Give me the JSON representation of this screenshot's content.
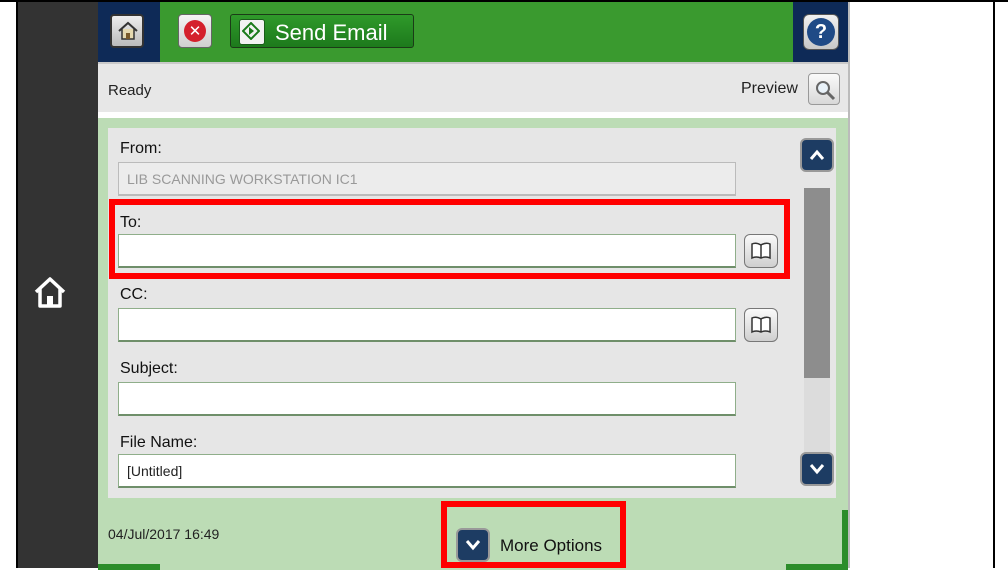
{
  "header": {
    "title": "Send Email",
    "home_icon": "home-icon",
    "cancel_icon": "cancel-icon",
    "help_icon": "help-icon"
  },
  "status": {
    "text": "Ready",
    "preview_label": "Preview"
  },
  "form": {
    "from": {
      "label": "From:",
      "value": "LIB SCANNING WORKSTATION IC1"
    },
    "to": {
      "label": "To:",
      "value": ""
    },
    "cc": {
      "label": "CC:",
      "value": ""
    },
    "subject": {
      "label": "Subject:",
      "value": ""
    },
    "file_name": {
      "label": "File Name:",
      "value": "[Untitled]"
    }
  },
  "footer": {
    "datetime": "04/Jul/2017 16:49",
    "more_options_label": "More Options"
  },
  "colors": {
    "brand_green": "#3a9a2f",
    "navy": "#0e2a57",
    "highlight": "#ff0000"
  }
}
